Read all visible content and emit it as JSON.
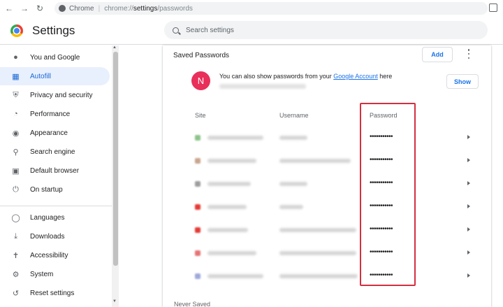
{
  "browser": {
    "tab_label": "Chrome",
    "url_scheme": "chrome://",
    "url_host": "settings",
    "url_path": "/passwords"
  },
  "header": {
    "title": "Settings",
    "search_placeholder": "Search settings"
  },
  "sidebar": {
    "items": [
      {
        "label": "You and Google",
        "icon": "person-icon"
      },
      {
        "label": "Autofill",
        "icon": "autofill-icon",
        "active": true
      },
      {
        "label": "Privacy and security",
        "icon": "shield-icon"
      },
      {
        "label": "Performance",
        "icon": "speedometer-icon"
      },
      {
        "label": "Appearance",
        "icon": "palette-icon"
      },
      {
        "label": "Search engine",
        "icon": "search-icon"
      },
      {
        "label": "Default browser",
        "icon": "browser-icon"
      },
      {
        "label": "On startup",
        "icon": "power-icon"
      },
      {
        "label": "Languages",
        "icon": "globe-icon"
      },
      {
        "label": "Downloads",
        "icon": "download-icon"
      },
      {
        "label": "Accessibility",
        "icon": "accessibility-icon"
      },
      {
        "label": "System",
        "icon": "wrench-icon"
      },
      {
        "label": "Reset settings",
        "icon": "reset-icon"
      }
    ]
  },
  "passwords": {
    "section_title": "Saved Passwords",
    "add_label": "Add",
    "promo": {
      "avatar_letter": "N",
      "text_before": "You can also show passwords from your ",
      "link": "Google Account",
      "text_after": " here",
      "show_label": "Show"
    },
    "columns": {
      "site": "Site",
      "username": "Username",
      "password": "Password"
    },
    "rows": [
      {
        "password": "•••••••••••",
        "favicon_color": "#8bc48a"
      },
      {
        "password": "•••••••••••",
        "favicon_color": "#c9a58f"
      },
      {
        "password": "•••••••••••",
        "favicon_color": "#9e9e9e"
      },
      {
        "password": "•••••••••••",
        "favicon_color": "#e53935"
      },
      {
        "password": "•••••••••••",
        "favicon_color": "#e53935"
      },
      {
        "password": "•••••••••••",
        "favicon_color": "#e57373"
      },
      {
        "password": "•••••••••••",
        "favicon_color": "#9fa8da"
      }
    ],
    "never_saved_title": "Never Saved"
  },
  "colors": {
    "accent": "#1a73e8",
    "active_bg": "#e8f0fe",
    "highlight_border": "#d32f3f",
    "avatar_bg": "#e8305a"
  }
}
